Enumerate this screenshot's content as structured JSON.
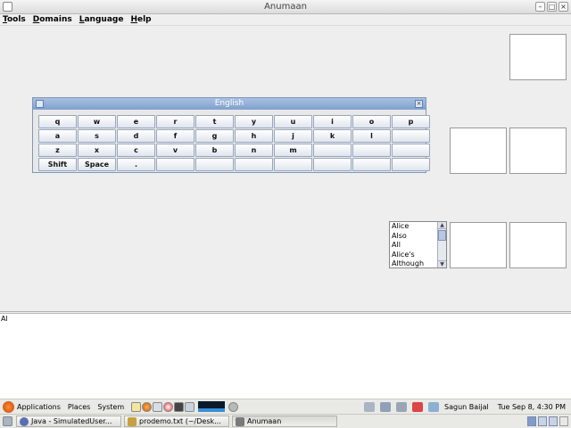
{
  "window": {
    "title": "Anumaan"
  },
  "menubar": {
    "items": [
      "Tools",
      "Domains",
      "Language",
      "Help"
    ]
  },
  "keyboard": {
    "title": "English",
    "rows": [
      [
        "q",
        "w",
        "e",
        "r",
        "t",
        "y",
        "u",
        "i",
        "o",
        "p"
      ],
      [
        "a",
        "s",
        "d",
        "f",
        "g",
        "h",
        "j",
        "k",
        "l",
        ""
      ],
      [
        "z",
        "x",
        "c",
        "v",
        "b",
        "n",
        "m",
        "",
        "",
        ""
      ],
      [
        "Shift",
        "Space",
        ".",
        "",
        "",
        "",
        "",
        "",
        "",
        ""
      ]
    ]
  },
  "suggestions": {
    "items": [
      "Alice",
      "Also",
      "All",
      "Alice's",
      "Although"
    ]
  },
  "textarea": {
    "content": "Al"
  },
  "top_panel": {
    "applications": "Applications",
    "places": "Places",
    "system": "System",
    "user": "Sagun Baijal",
    "clock": "Tue Sep  8,  4:30 PM"
  },
  "taskbar": {
    "tasks": [
      {
        "label": "Java - SimulatedUser...",
        "icon_color": "#5a6fb0"
      },
      {
        "label": "prodemo.txt (~/Desk...",
        "icon_color": "#c8a040"
      },
      {
        "label": "Anumaan",
        "icon_color": "#7a7a7a"
      }
    ]
  },
  "colors": {
    "accent": "#7ea0cf",
    "panel": "#e9e9e6"
  }
}
